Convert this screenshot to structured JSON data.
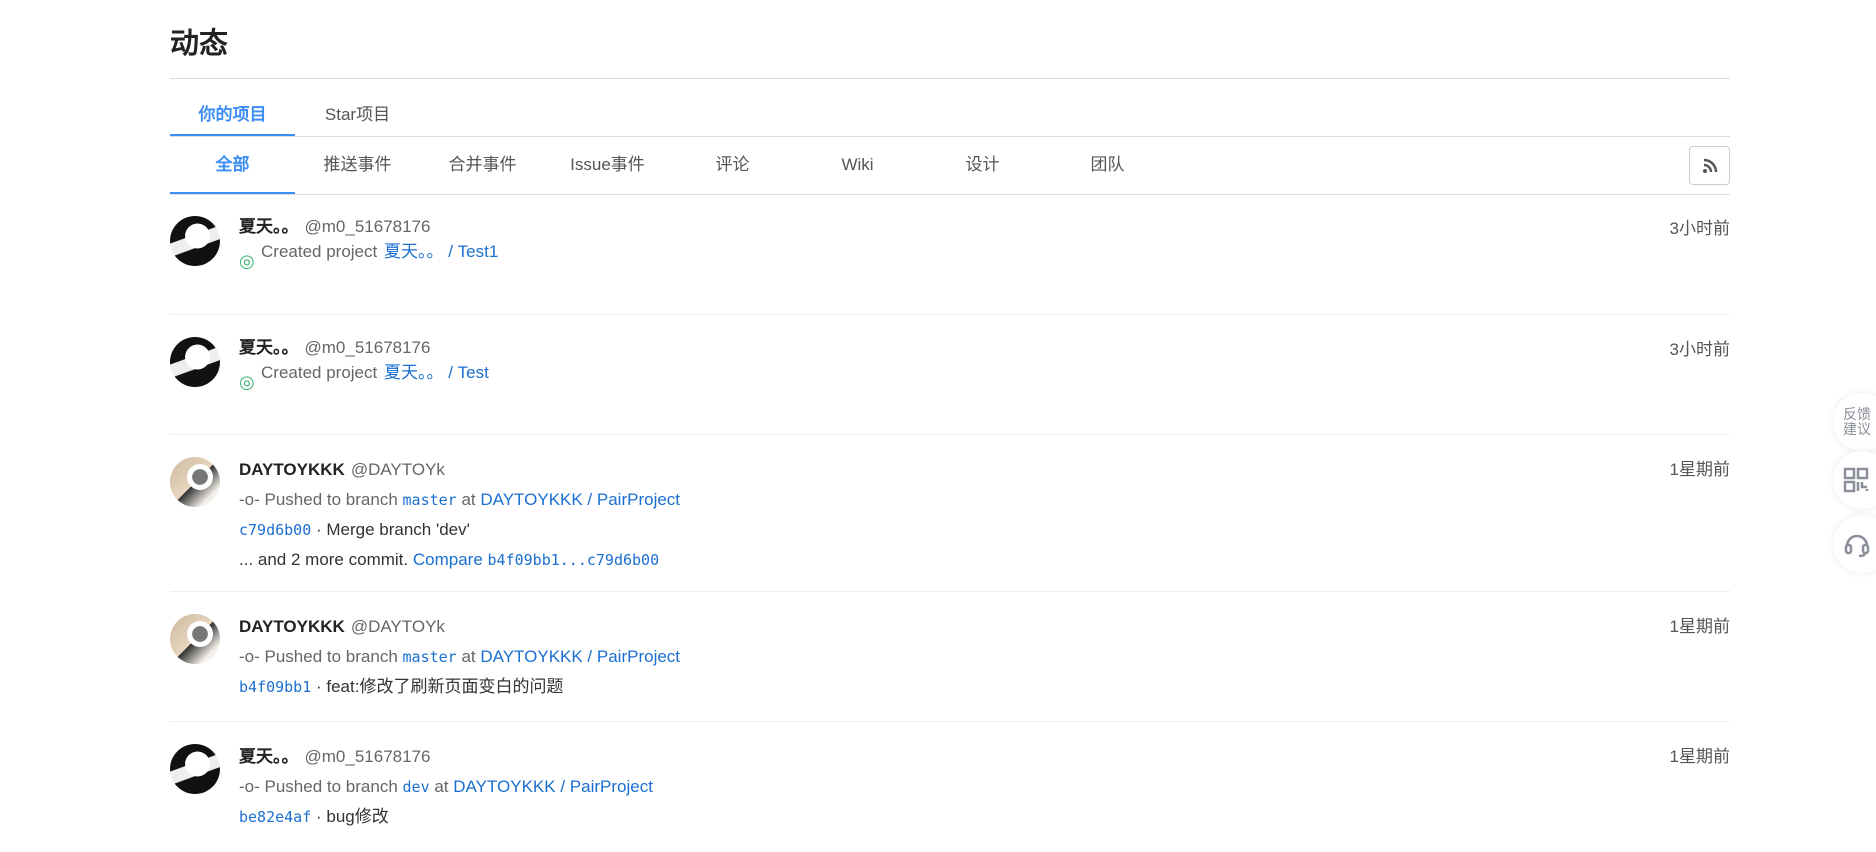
{
  "page_title": "动态",
  "main_tabs": [
    {
      "label": "你的项目",
      "active": true
    },
    {
      "label": "Star项目",
      "active": false
    }
  ],
  "filter_tabs": [
    {
      "label": "全部",
      "active": true
    },
    {
      "label": "推送事件"
    },
    {
      "label": "合并事件"
    },
    {
      "label": "Issue事件"
    },
    {
      "label": "评论"
    },
    {
      "label": "Wiki"
    },
    {
      "label": "设计"
    },
    {
      "label": "团队"
    }
  ],
  "events": [
    {
      "name": "夏天。。",
      "handle": "@m0_51678176",
      "time": "3小时前",
      "action": "Created project",
      "project": "夏天。。 / Test1"
    },
    {
      "name": "夏天。。",
      "handle": "@m0_51678176",
      "time": "3小时前",
      "action": "Created project",
      "project": "夏天。。 / Test"
    },
    {
      "name": "DAYTOYKKK",
      "handle": "@DAYTOYk",
      "time": "1星期前",
      "action": "Pushed to branch",
      "branch": "master",
      "at": "at",
      "project": "DAYTOYKKK / PairProject",
      "commit": "c79d6b00",
      "message": "Merge branch 'dev'",
      "more": "... and 2 more commit.",
      "compare_label": "Compare",
      "compare_range": "b4f09bb1...c79d6b00"
    },
    {
      "name": "DAYTOYKKK",
      "handle": "@DAYTOYk",
      "time": "1星期前",
      "action": "Pushed to branch",
      "branch": "master",
      "at": "at",
      "project": "DAYTOYKKK / PairProject",
      "commit": "b4f09bb1",
      "message": "feat:修改了刷新页面变白的问题"
    },
    {
      "name": "夏天。。",
      "handle": "@m0_51678176",
      "time": "1星期前",
      "action": "Pushed to branch",
      "branch": "dev",
      "at": "at",
      "project": "DAYTOYKKK / PairProject",
      "commit": "be82e4af",
      "message": "bug修改"
    }
  ],
  "floating": {
    "feedback_line1": "反馈",
    "feedback_line2": "建议"
  },
  "colors": {
    "accent": "#3d8ef5",
    "link": "#1a6fd1",
    "created_icon": "#3cb371"
  }
}
